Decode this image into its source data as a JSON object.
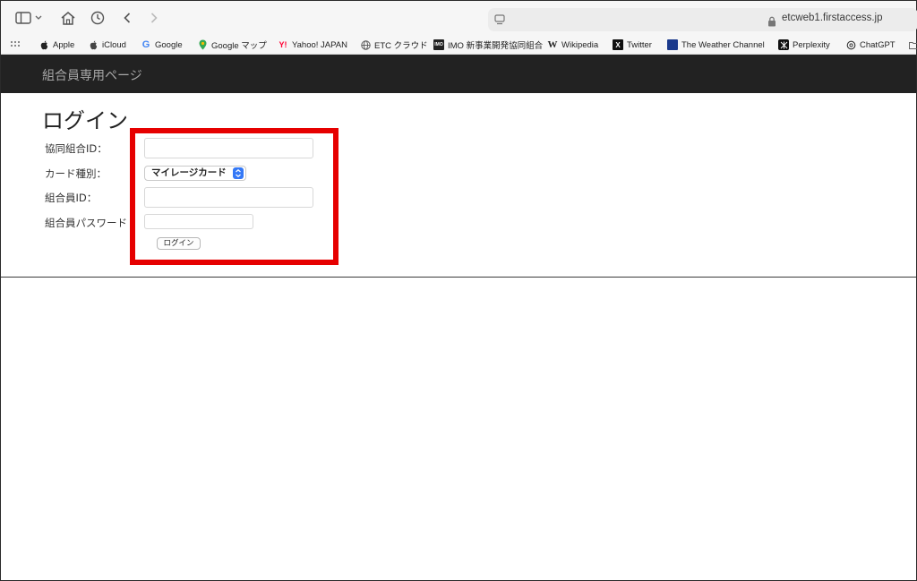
{
  "browser": {
    "url": "etcweb1.firstaccess.jp",
    "bookmarks": [
      {
        "label": "Apple",
        "icon": "apple-icon"
      },
      {
        "label": "iCloud",
        "icon": "apple-icon"
      },
      {
        "label": "Google",
        "icon": "google-icon"
      },
      {
        "label": "Google マップ",
        "icon": "maps-pin-icon"
      },
      {
        "label": "Yahoo! JAPAN",
        "icon": "yahoo-icon"
      },
      {
        "label": "ETC クラウド",
        "icon": "globe-icon"
      },
      {
        "label": "IMO 新事業開発協同組合",
        "icon": "imo-icon"
      },
      {
        "label": "Wikipedia",
        "icon": "wikipedia-icon"
      },
      {
        "label": "Twitter",
        "icon": "x-icon"
      },
      {
        "label": "The Weather Channel",
        "icon": "weather-channel-icon"
      },
      {
        "label": "Perplexity",
        "icon": "perplexity-icon"
      },
      {
        "label": "ChatGPT",
        "icon": "chatgpt-icon"
      }
    ]
  },
  "site": {
    "title": "組合員専用ページ"
  },
  "login": {
    "heading": "ログイン",
    "coop_id_label": "協同組合ID：",
    "card_type_label": "カード種別：",
    "card_type_value": "マイレージカード",
    "member_id_label": "組合員ID：",
    "password_label": "組合員パスワード",
    "submit_label": "ログイン"
  },
  "colors": {
    "header_bg": "#222222",
    "highlight": "#e60000",
    "select_accent": "#3478f6"
  }
}
